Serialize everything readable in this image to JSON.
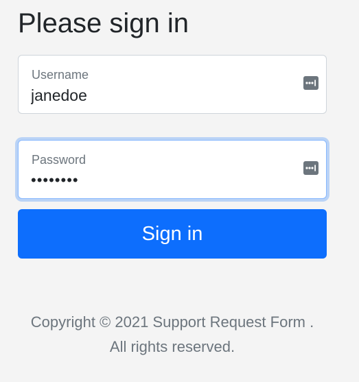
{
  "form": {
    "title": "Please sign in",
    "username": {
      "label": "Username",
      "value": "janedoe",
      "icon": "password-manager-icon"
    },
    "password": {
      "label": "Password",
      "value": "••••••••",
      "icon": "password-manager-icon",
      "focused": true
    },
    "submit_label": "Sign in"
  },
  "footer": {
    "line1": "Copyright © 2021 Support Request Form .",
    "line2": "All rights reserved."
  },
  "colors": {
    "background": "#f4f4f4",
    "primary": "#0d6efd",
    "focus_ring": "#86b7fe",
    "muted_text": "#6c757d",
    "icon": "#6c757d"
  }
}
